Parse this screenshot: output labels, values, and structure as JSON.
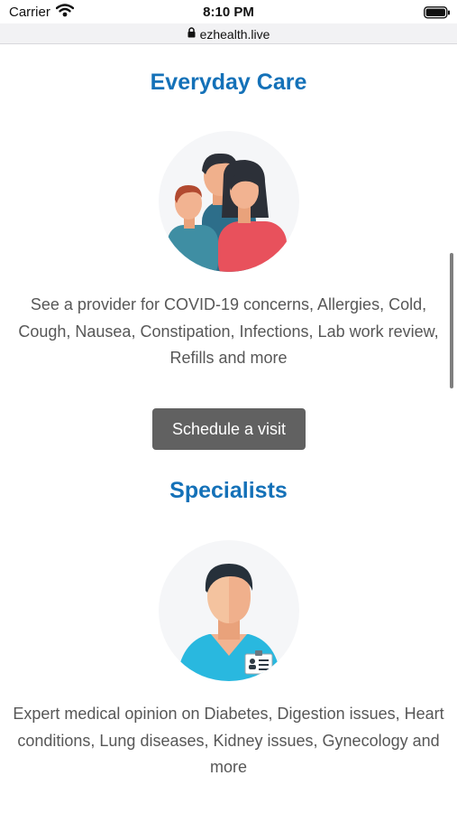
{
  "status_bar": {
    "carrier": "Carrier",
    "time": "8:10 PM",
    "icons": [
      "wifi-icon",
      "battery-icon"
    ]
  },
  "browser": {
    "url": "ezhealth.live",
    "icons": [
      "lock-icon"
    ]
  },
  "sections": [
    {
      "title": "Everyday Care",
      "description": "See a provider for COVID-19 concerns, Allergies, Cold, Cough, Nausea, Constipation, Infections, Lab work review, Refills and more",
      "button_label": "Schedule a visit",
      "illustration": "family-illustration"
    },
    {
      "title": "Specialists",
      "description": "Expert medical opinion on Diabetes, Digestion issues, Heart conditions, Lung diseases, Kidney issues, Gynecology and more",
      "illustration": "doctor-illustration"
    }
  ],
  "colors": {
    "title": "#1471b8",
    "button_bg": "#616161",
    "button_text": "#ffffff",
    "body_text": "#575757",
    "illustration_bg": "#f5f6f8"
  }
}
